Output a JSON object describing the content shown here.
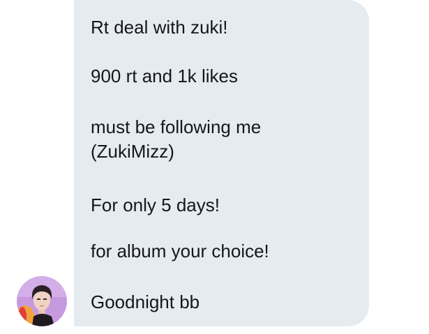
{
  "message": {
    "lines": [
      "Rt deal with zuki!",
      "900 rt and 1k likes",
      "must be following me",
      "(ZukiMizz)",
      "For only 5 days!",
      "for album your choice!",
      "Goodnight bb"
    ]
  },
  "colors": {
    "bubble_background": "#e6ebf0",
    "text": "#14171a",
    "avatar_background": "#c79ae0"
  }
}
